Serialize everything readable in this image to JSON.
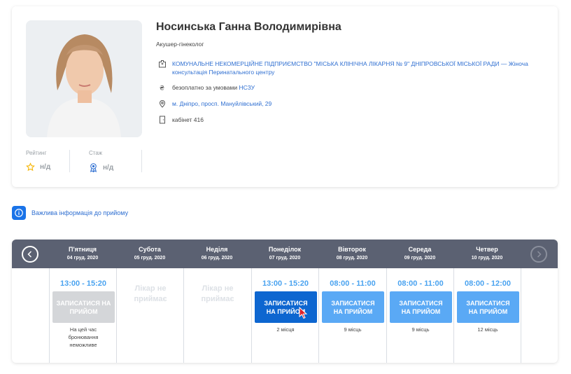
{
  "doctor": {
    "name": "Носинська Ганна Володимирівна",
    "specialty": "Акушер-гінеколог",
    "clinic": "КОМУНАЛЬНЕ НЕКОМЕРЦІЙНЕ ПІДПРИЄМСТВО \"МІСЬКА КЛІНІЧНА ЛІКАРНЯ № 9\" ДНІПРОВСЬКОЇ МІСЬКОЇ РАДИ — Жіноча консультація Перинатального центру",
    "payment_prefix": "безоплатно за умовами",
    "payment_link": "НСЗУ",
    "address": "м. Дніпро, просп. Мануйлівський, 29",
    "room": "кабінет 416",
    "rating_label": "Рейтинг",
    "rating_value": "н/д",
    "experience_label": "Стаж",
    "experience_value": "н/д"
  },
  "notice": "Важлива інформація до прийому",
  "colors": {
    "accent": "#1a73e8",
    "link": "#2f6fd1",
    "header_bg": "#5b6172",
    "slot_dark": "#0d66d0",
    "slot_light": "#5aa9f5",
    "star": "#f5b400"
  },
  "schedule": {
    "days": [
      {
        "name": "П'ятниця",
        "date": "04 груд. 2020",
        "time": "13:00 - 15:20",
        "button": "ЗАПИСАТИСЯ НА ПРИЙОМ",
        "state": "disabled",
        "note": "На цей час бронювання неможливе"
      },
      {
        "name": "Субота",
        "date": "05 груд. 2020",
        "time": "",
        "button": "",
        "state": "off",
        "note": "Лікар не приймає"
      },
      {
        "name": "Неділя",
        "date": "06 груд. 2020",
        "time": "",
        "button": "",
        "state": "off",
        "note": "Лікар не приймає"
      },
      {
        "name": "Понеділок",
        "date": "07 груд. 2020",
        "time": "13:00 - 15:20",
        "button": "ЗАПИСАТИСЯ НА ПРИЙОМ",
        "state": "active",
        "note": "2 місця"
      },
      {
        "name": "Вівторок",
        "date": "08 груд. 2020",
        "time": "08:00 - 11:00",
        "button": "ЗАПИСАТИСЯ НА ПРИЙОМ",
        "state": "available",
        "note": "9 місць"
      },
      {
        "name": "Середа",
        "date": "09 груд. 2020",
        "time": "08:00 - 11:00",
        "button": "ЗАПИСАТИСЯ НА ПРИЙОМ",
        "state": "available",
        "note": "9 місць"
      },
      {
        "name": "Четвер",
        "date": "10 груд. 2020",
        "time": "08:00 - 12:00",
        "button": "ЗАПИСАТИСЯ НА ПРИЙОМ",
        "state": "available",
        "note": "12 місць"
      }
    ]
  }
}
